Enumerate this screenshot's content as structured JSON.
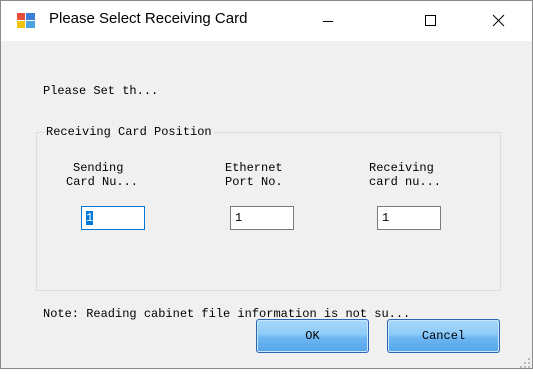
{
  "window": {
    "title": "Please Select Receiving Card",
    "app_icon": "app-window-icon",
    "controls": [
      "minimize-icon",
      "maximize-icon",
      "close-icon"
    ]
  },
  "dialog": {
    "prompt": "Please Set th...",
    "group_title": "Receiving Card Position",
    "fields": [
      {
        "label_line1": "Sending",
        "label_line2": "Card Nu...",
        "value": "1",
        "focused": true
      },
      {
        "label_line1": "Ethernet",
        "label_line2": "Port No.",
        "value": "1",
        "focused": false
      },
      {
        "label_line1": "Receiving",
        "label_line2": "card nu...",
        "value": "1",
        "focused": false
      }
    ],
    "note": "Note: Reading cabinet file information is not su...",
    "buttons": {
      "ok": "OK",
      "cancel": "Cancel"
    }
  },
  "colors": {
    "accent": "#0078d7",
    "button_gradient_top": "#a8d8fb",
    "button_gradient_bottom": "#55a6ea",
    "client_background": "#f0f0f0"
  }
}
